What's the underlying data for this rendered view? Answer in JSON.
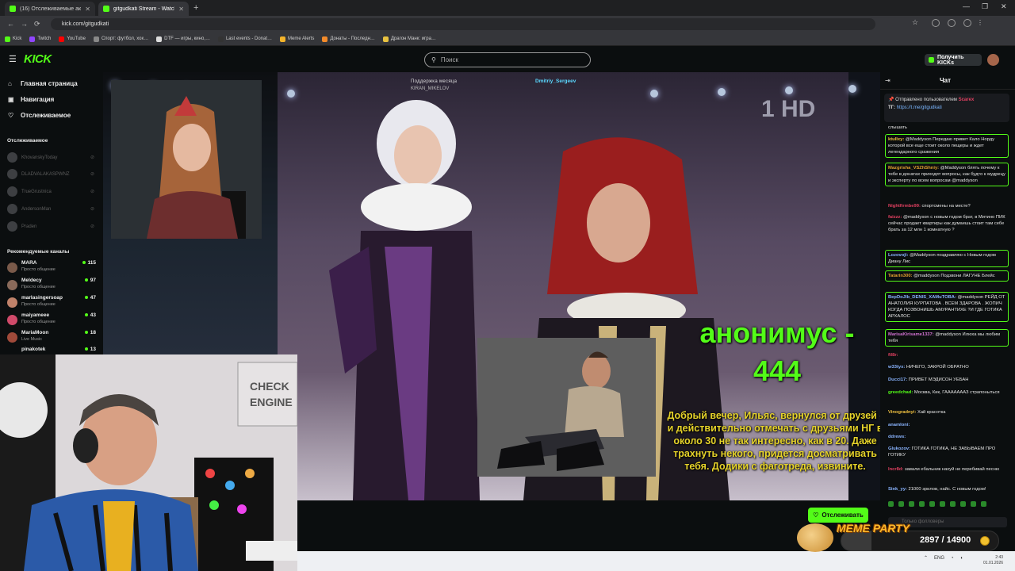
{
  "browser": {
    "tabs": [
      {
        "title": "(16) Отслеживаемые активн…",
        "active": false
      },
      {
        "title": "gitgudkati Stream - Watch …",
        "active": true
      }
    ],
    "url": "kick.com/gitgudkati",
    "bookmarks": [
      "Kick",
      "Twitch",
      "YouTube",
      "Спорт: футбол, хок…",
      "DTF — игры, кино,…",
      "Last events - Donat…",
      "Meme Alerts",
      "Донаты - Последн…",
      "Драгон Манк: игра…"
    ]
  },
  "header": {
    "logo": "KICK",
    "search_placeholder": "Поиск",
    "get_kicks": "Получить KICKs"
  },
  "sidebar": {
    "nav": [
      {
        "label": "Главная страница",
        "icon": "home-icon"
      },
      {
        "label": "Навигация",
        "icon": "compass-icon"
      },
      {
        "label": "Отслеживаемое",
        "icon": "heart-icon"
      }
    ],
    "following_title": "Отслеживаемое",
    "following": [
      "KhovanskyToday",
      "DLADVALAKASPWNZ",
      "TrueGrustnica",
      "AndersonMan",
      "Praden"
    ],
    "recommended_title": "Рекомендуемые каналы",
    "recommended": [
      {
        "name": "MARA",
        "category": "Просто общение",
        "viewers": "115"
      },
      {
        "name": "Meldecy",
        "category": "Просто общение",
        "viewers": "97"
      },
      {
        "name": "marlasingersoap",
        "category": "Просто общение",
        "viewers": "47"
      },
      {
        "name": "maiyameee",
        "category": "Просто общение",
        "viewers": "43"
      },
      {
        "name": "MariaMoon",
        "category": "Live Music",
        "viewers": "18"
      },
      {
        "name": "pinakotek",
        "category": "",
        "viewers": "13"
      }
    ]
  },
  "stream": {
    "donation_bar_line1": "Поддержка месяца",
    "donation_bar_line2": "Dmitriy_Sergeev",
    "donation_name": "KIRAN_MIKELOV",
    "channel_logo": "1 HD",
    "overlay_title": "анонимус - 444",
    "overlay_text": "Добрый вечер, Ильяс, вернулся от друзей - и действительно отмечать с друзьями НГ в около 30 не так интересно, как в 20. Даже трахнуть некого, придется досматривать тебя. Додики с фаготреда, извините.",
    "meme_title": "MEME PARTY",
    "meme_progress": "2897 / 14900",
    "meme_progress_fraction": 0.194,
    "follow_button": "Отслеживать"
  },
  "chat": {
    "title": "Чат",
    "pinned_by": "Отправлено пользователем",
    "pinned_user": "Scarex",
    "pinned_text": "ТГ:",
    "pinned_link": "https://t.me/gitgudkati",
    "messages": [
      {
        "user": "",
        "text": "слышать",
        "color": "#e6e6e6",
        "hl": false
      },
      {
        "user": "ktullxy:",
        "text": "@Maddyson Передаю привет Кало Норду которой все еще стоит около пещеры и ждет легендарного сражения",
        "color": "#f0c040",
        "hl": true
      },
      {
        "user": "Mazgrisha_VSZhShniy:",
        "text": "@Maddyson блять почему к тебе в донатах приходят вопросы, как будто к мудрецу и эксперту по всем вопросам @maddyson",
        "color": "#e0a030",
        "hl": true
      },
      {
        "user": "Nightfirmbe99:",
        "text": "спортсмены на месте?",
        "color": "#e04060",
        "hl": false
      },
      {
        "user": "faizzz:",
        "text": "@maddyson с новым годом брат, в Митино ПИК сейчас продает квартиры как думаешь стоит там себе брать за 12 млн 1 комнатную ?",
        "color": "#e04060",
        "hl": false
      },
      {
        "user": "Lozovoji:",
        "text": "@Maddyson поздравляю с Новым годом Диану Лис",
        "color": "#8ab4ff",
        "hl": true
      },
      {
        "user": "Tatarin300:",
        "text": "@maddyson Подзвони ЛАГУНЕ Блейс",
        "color": "#e0a030",
        "hl": true
      },
      {
        "user": "BepDoJlb_DENIS_XAMuTOBA:",
        "text": "@maddyson РЕЙД ОТ АНАТОЛИЯ КУРПАТОВА . ВСЕМ ЗДАРОВА . ЖОПИЧ КОГДА ПОЗВОНИШЬ АМУРАНТИХЕ ?И ГДЕ ГОТИКА АРХАЛОС",
        "color": "#8ab4ff",
        "hl": true
      },
      {
        "user": "MarisaKirisame1337:",
        "text": "@maddyson Илюха мы любим тебя",
        "color": "#d070d0",
        "hl": true
      },
      {
        "user": "fil8r:",
        "text": "",
        "color": "#e04060",
        "hl": false
      },
      {
        "user": "w33tyx:",
        "text": "НИЧЕГО, ЗАКРОЙ ОБРАТНО",
        "color": "#8ab4ff",
        "hl": false
      },
      {
        "user": "Ducci17:",
        "text": "ПРИВЕТ МЭДИСОН УЕБАН",
        "color": "#8ab4ff",
        "hl": false
      },
      {
        "user": "greedchad:",
        "text": "Москва, Кик, ГАААААААЗ страпоныться",
        "color": "#53fc18",
        "hl": false
      },
      {
        "user": "Vinogradnyi:",
        "text": "Хай красотка",
        "color": "#f0c040",
        "hl": false
      },
      {
        "user": "anamloni:",
        "text": "",
        "color": "#8ab4ff",
        "hl": false
      },
      {
        "user": "ddrews:",
        "text": "",
        "color": "#8ab4ff",
        "hl": false
      },
      {
        "user": "Glukozov:",
        "text": "ГОТИКА ГОТИКА, НЕ ЗАБЫВАЕМ ПРО ГОТИКУ",
        "color": "#8ab4ff",
        "hl": false
      },
      {
        "user": "Incr8d:",
        "text": "завали ебальник нахуй не перебивай песню",
        "color": "#e04060",
        "hl": false
      },
      {
        "user": "Sink_yy:",
        "text": "21000 зрилов, найс. С новым годом!",
        "color": "#8ab4ff",
        "hl": false
      }
    ],
    "input_placeholder": "Только фолловеры"
  },
  "taskbar": {
    "lang": "ENG",
    "time": "2:43",
    "date": "01.01.2026"
  }
}
